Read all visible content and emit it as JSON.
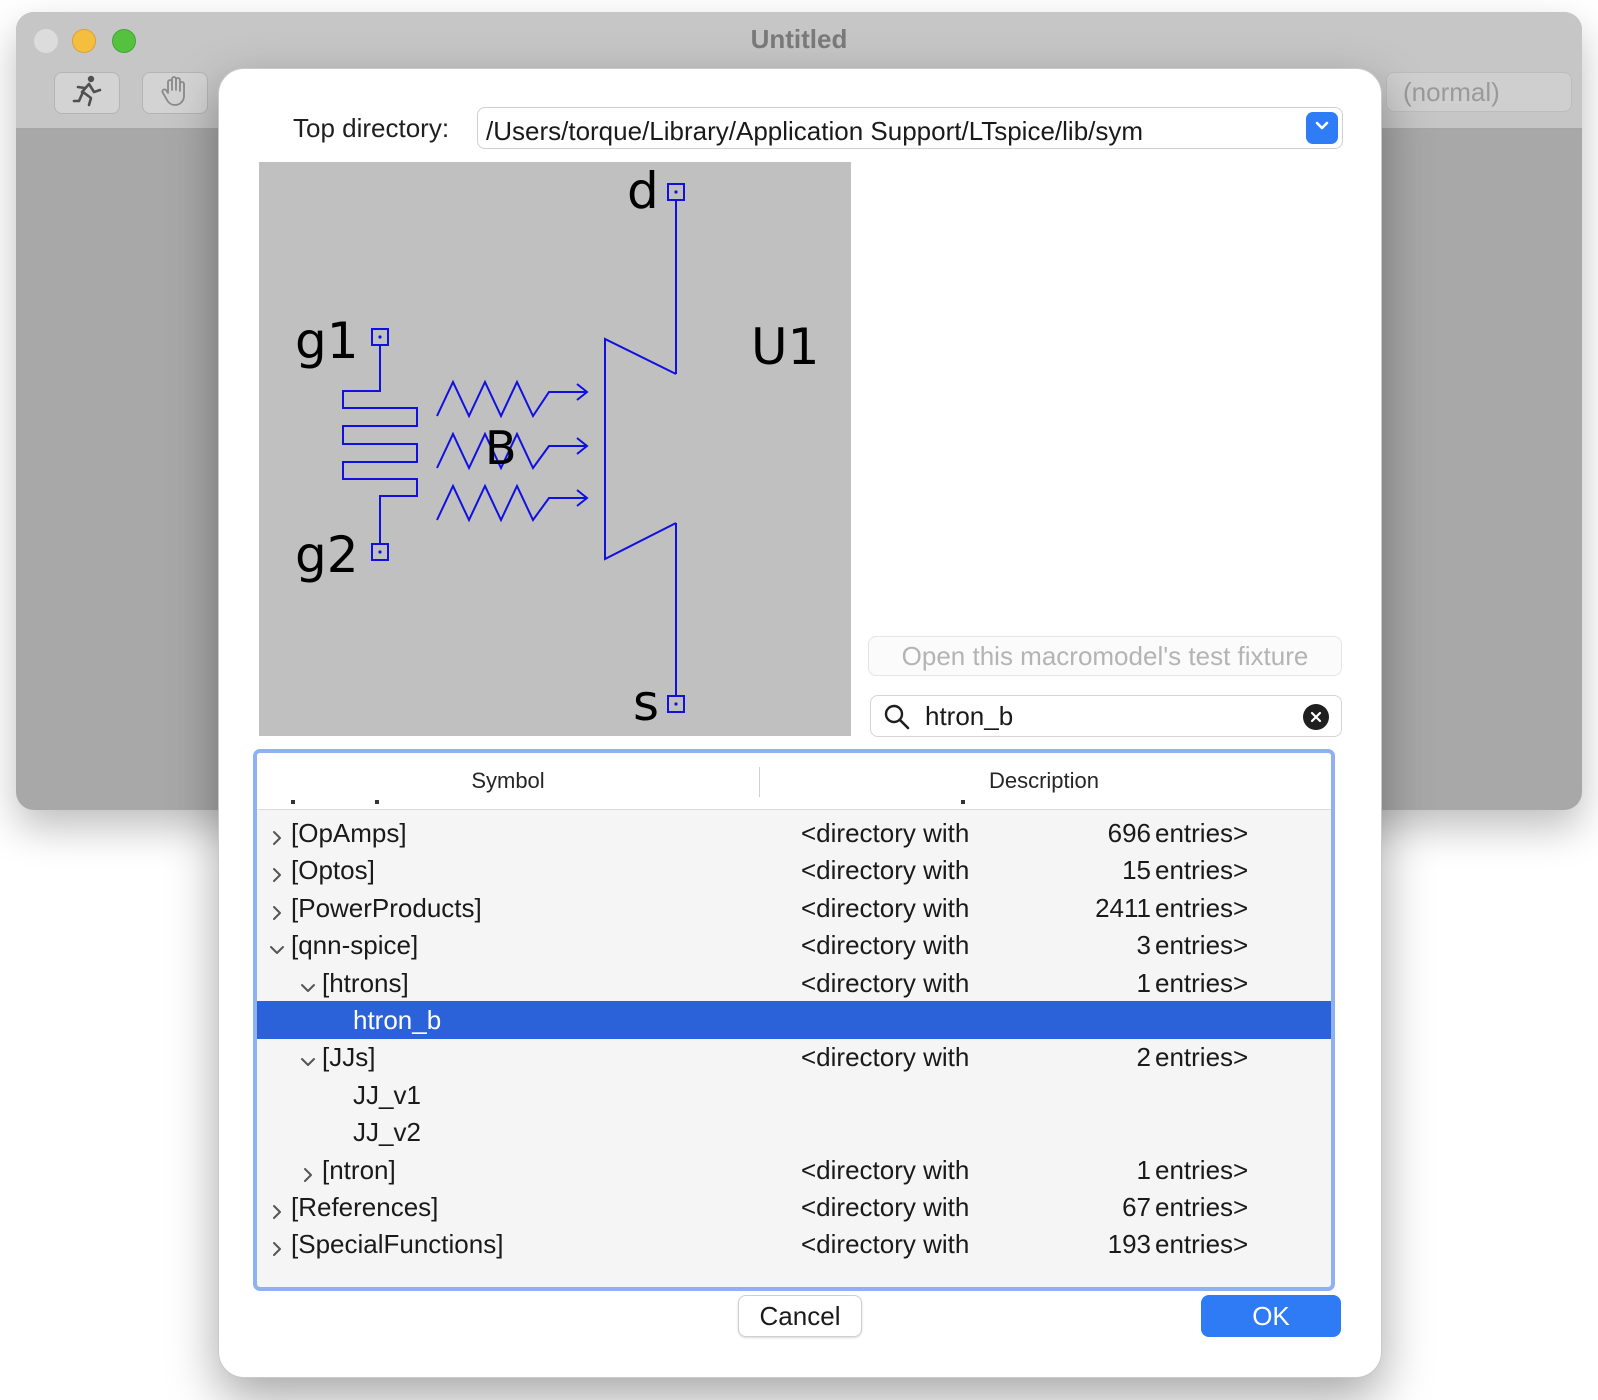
{
  "window": {
    "title": "Untitled",
    "mode_label": "(normal)"
  },
  "dialog": {
    "top_directory_label": "Top directory:",
    "top_directory_value": "/Users/torque/Library/Application Support/LTspice/lib/sym",
    "fixture_button_label": "Open this macromodel's test fixture",
    "search_value": "htron_b",
    "cancel_label": "Cancel",
    "ok_label": "OK"
  },
  "symbol_preview": {
    "pin_drain": "d",
    "pin_source": "s",
    "pin_gate1": "g1",
    "pin_gate2": "g2",
    "instance_name": "U1",
    "field_label": "B",
    "stroke_color": "#1010e0",
    "background_color": "#c0c0c0"
  },
  "table": {
    "columns": [
      "Symbol",
      "Description"
    ],
    "rows": [
      {
        "name": "[OpAmps]",
        "desc_prefix": "<directory with",
        "desc_count": "696",
        "desc_suffix": "entries>",
        "expanded": false,
        "has_children": true
      },
      {
        "name": "[Optos]",
        "desc_prefix": "<directory with",
        "desc_count": "15",
        "desc_suffix": "entries>",
        "expanded": false,
        "has_children": true
      },
      {
        "name": "[PowerProducts]",
        "desc_prefix": "<directory with",
        "desc_count": "2411",
        "desc_suffix": "entries>",
        "expanded": false,
        "has_children": true
      },
      {
        "name": "[qnn-spice]",
        "desc_prefix": "<directory with",
        "desc_count": "3",
        "desc_suffix": "entries>",
        "expanded": true,
        "has_children": true
      },
      {
        "name": "[htrons]",
        "desc_prefix": "<directory with",
        "desc_count": "1",
        "desc_suffix": "entries>",
        "expanded": true,
        "has_children": true
      },
      {
        "name": "htron_b",
        "desc_prefix": "",
        "desc_count": "",
        "desc_suffix": "",
        "selected": true,
        "has_children": false
      },
      {
        "name": "[JJs]",
        "desc_prefix": "<directory with",
        "desc_count": "2",
        "desc_suffix": "entries>",
        "expanded": true,
        "has_children": true
      },
      {
        "name": "JJ_v1",
        "desc_prefix": "",
        "desc_count": "",
        "desc_suffix": "",
        "has_children": false
      },
      {
        "name": "JJ_v2",
        "desc_prefix": "",
        "desc_count": "",
        "desc_suffix": "",
        "has_children": false
      },
      {
        "name": "[ntron]",
        "desc_prefix": "<directory with",
        "desc_count": "1",
        "desc_suffix": "entries>",
        "expanded": false,
        "has_children": true
      },
      {
        "name": "[References]",
        "desc_prefix": "<directory with",
        "desc_count": "67",
        "desc_suffix": "entries>",
        "expanded": false,
        "has_children": true
      },
      {
        "name": "[SpecialFunctions]",
        "desc_prefix": "<directory with",
        "desc_count": "193",
        "desc_suffix": "entries>",
        "expanded": false,
        "has_children": true
      }
    ]
  },
  "colors": {
    "accent": "#2f7af5",
    "selection": "#2b62d9",
    "focus_ring": "#8fb0f3"
  }
}
